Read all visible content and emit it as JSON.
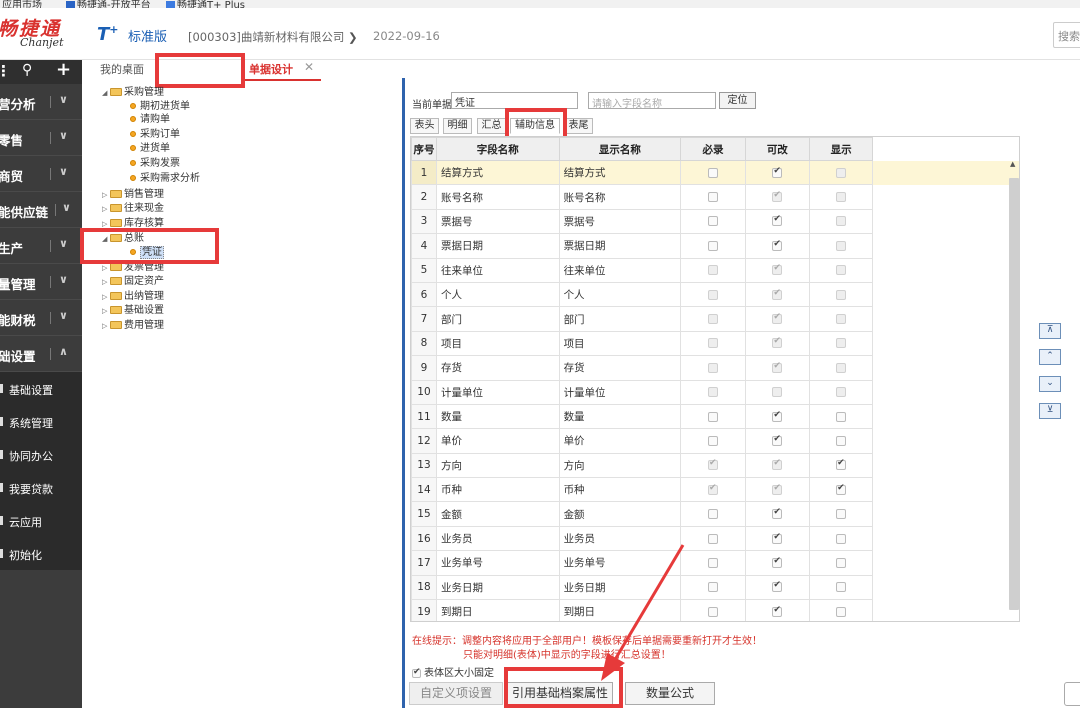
{
  "bookmarks": [
    "应用市场",
    "畅捷通-开放平台",
    "畅捷通T+ Plus"
  ],
  "header": {
    "logo_cn": "畅捷通",
    "logo_en": "Chanjet",
    "product": "T+",
    "edition": "标准版",
    "company": "[000303]曲靖新材料有限公司",
    "date": "2022-09-16",
    "search_placeholder": "搜索"
  },
  "sidebar": {
    "items": [
      {
        "label": "营分析"
      },
      {
        "label": "零售"
      },
      {
        "label": "商贸"
      },
      {
        "label": "能供应链"
      },
      {
        "label": "生产"
      },
      {
        "label": "量管理"
      },
      {
        "label": "能财税"
      },
      {
        "label": "础设置"
      }
    ],
    "subitems": [
      {
        "label": "基础设置"
      },
      {
        "label": "系统管理"
      },
      {
        "label": "协同办公"
      },
      {
        "label": "我要贷款"
      },
      {
        "label": "云应用"
      },
      {
        "label": "初始化"
      }
    ]
  },
  "tabs": {
    "desk": "我的桌面",
    "active": "单据设计"
  },
  "tree": [
    {
      "label": "采购管理",
      "type": "folder",
      "level": 0,
      "expanded": true
    },
    {
      "label": "期初进货单",
      "type": "leaf",
      "level": 1
    },
    {
      "label": "请购单",
      "type": "leaf",
      "level": 1
    },
    {
      "label": "采购订单",
      "type": "leaf",
      "level": 1
    },
    {
      "label": "进货单",
      "type": "leaf",
      "level": 1
    },
    {
      "label": "采购发票",
      "type": "leaf",
      "level": 1
    },
    {
      "label": "采购需求分析",
      "type": "leaf",
      "level": 1
    },
    {
      "label": "销售管理",
      "type": "folder",
      "level": 0,
      "expanded": false
    },
    {
      "label": "往来现金",
      "type": "folder",
      "level": 0,
      "expanded": false
    },
    {
      "label": "库存核算",
      "type": "folder",
      "level": 0,
      "expanded": false
    },
    {
      "label": "总账",
      "type": "folder",
      "level": 0,
      "expanded": true
    },
    {
      "label": "凭证",
      "type": "leaf",
      "level": 1,
      "selected": true
    },
    {
      "label": "发票管理",
      "type": "folder",
      "level": 0,
      "expanded": false
    },
    {
      "label": "固定资产",
      "type": "folder",
      "level": 0,
      "expanded": false
    },
    {
      "label": "出纳管理",
      "type": "folder",
      "level": 0,
      "expanded": false
    },
    {
      "label": "基础设置",
      "type": "folder",
      "level": 0,
      "expanded": false
    },
    {
      "label": "费用管理",
      "type": "folder",
      "level": 0,
      "expanded": false
    }
  ],
  "form": {
    "current_label": "当前单据",
    "current_value": "凭证",
    "field_placeholder": "请输入字段名称",
    "locate_btn": "定位"
  },
  "subtabs": [
    {
      "label": "表头",
      "active": false
    },
    {
      "label": "明细",
      "active": false
    },
    {
      "label": "汇总",
      "active": false
    },
    {
      "label": "辅助信息",
      "active": true
    },
    {
      "label": "表尾",
      "active": false
    }
  ],
  "grid": {
    "columns": [
      "序号",
      "字段名称",
      "显示名称",
      "必录",
      "可改",
      "显示"
    ],
    "rows": [
      {
        "no": "1",
        "field": "结算方式",
        "display": "结算方式",
        "req": false,
        "req_dis": false,
        "edit": true,
        "edit_dis": false,
        "show": false,
        "show_dis": true
      },
      {
        "no": "2",
        "field": "账号名称",
        "display": "账号名称",
        "req": false,
        "req_dis": false,
        "edit": true,
        "edit_dis": true,
        "show": false,
        "show_dis": true
      },
      {
        "no": "3",
        "field": "票据号",
        "display": "票据号",
        "req": false,
        "req_dis": false,
        "edit": true,
        "edit_dis": false,
        "show": false,
        "show_dis": true
      },
      {
        "no": "4",
        "field": "票据日期",
        "display": "票据日期",
        "req": false,
        "req_dis": false,
        "edit": true,
        "edit_dis": false,
        "show": false,
        "show_dis": true
      },
      {
        "no": "5",
        "field": "往来单位",
        "display": "往来单位",
        "req": false,
        "req_dis": true,
        "edit": true,
        "edit_dis": true,
        "show": false,
        "show_dis": true
      },
      {
        "no": "6",
        "field": "个人",
        "display": "个人",
        "req": false,
        "req_dis": true,
        "edit": true,
        "edit_dis": true,
        "show": false,
        "show_dis": true
      },
      {
        "no": "7",
        "field": "部门",
        "display": "部门",
        "req": false,
        "req_dis": true,
        "edit": true,
        "edit_dis": true,
        "show": false,
        "show_dis": true
      },
      {
        "no": "8",
        "field": "项目",
        "display": "项目",
        "req": false,
        "req_dis": true,
        "edit": true,
        "edit_dis": true,
        "show": false,
        "show_dis": true
      },
      {
        "no": "9",
        "field": "存货",
        "display": "存货",
        "req": false,
        "req_dis": true,
        "edit": true,
        "edit_dis": true,
        "show": false,
        "show_dis": true
      },
      {
        "no": "10",
        "field": "计量单位",
        "display": "计量单位",
        "req": false,
        "req_dis": true,
        "edit": false,
        "edit_dis": true,
        "show": false,
        "show_dis": true
      },
      {
        "no": "11",
        "field": "数量",
        "display": "数量",
        "req": false,
        "req_dis": false,
        "edit": true,
        "edit_dis": false,
        "show": false,
        "show_dis": false
      },
      {
        "no": "12",
        "field": "单价",
        "display": "单价",
        "req": false,
        "req_dis": false,
        "edit": true,
        "edit_dis": false,
        "show": false,
        "show_dis": false
      },
      {
        "no": "13",
        "field": "方向",
        "display": "方向",
        "req": true,
        "req_dis": true,
        "edit": true,
        "edit_dis": true,
        "show": true,
        "show_dis": false
      },
      {
        "no": "14",
        "field": "币种",
        "display": "币种",
        "req": true,
        "req_dis": true,
        "edit": true,
        "edit_dis": true,
        "show": true,
        "show_dis": false
      },
      {
        "no": "15",
        "field": "金额",
        "display": "金额",
        "req": false,
        "req_dis": false,
        "edit": true,
        "edit_dis": false,
        "show": false,
        "show_dis": false
      },
      {
        "no": "16",
        "field": "业务员",
        "display": "业务员",
        "req": false,
        "req_dis": false,
        "edit": true,
        "edit_dis": false,
        "show": false,
        "show_dis": false
      },
      {
        "no": "17",
        "field": "业务单号",
        "display": "业务单号",
        "req": false,
        "req_dis": false,
        "edit": true,
        "edit_dis": false,
        "show": false,
        "show_dis": false
      },
      {
        "no": "18",
        "field": "业务日期",
        "display": "业务日期",
        "req": false,
        "req_dis": false,
        "edit": true,
        "edit_dis": false,
        "show": false,
        "show_dis": false
      },
      {
        "no": "19",
        "field": "到期日",
        "display": "到期日",
        "req": false,
        "req_dis": false,
        "edit": true,
        "edit_dis": false,
        "show": false,
        "show_dis": false
      }
    ]
  },
  "move_buttons": [
    "置顶",
    "上移",
    "下移",
    "置底"
  ],
  "tips": {
    "line1": "在线提示：调整内容将应用于全部用户！模板保存后单据需要重新打开才生效！",
    "line2": "只能对明细(表体)中显示的字段进行汇总设置！"
  },
  "fix_area": {
    "label": "表体区大小固定",
    "checked": true
  },
  "buttons": {
    "custom_items": "自定义项设置",
    "ref_attr": "引用基础档案属性",
    "qty_formula": "数量公式"
  },
  "colors": {
    "accent_red": "#d9322f",
    "brand_blue": "#1a5fb4",
    "sidebar_bg": "#3c3c3c",
    "annotation_red": "#e63a3a"
  }
}
